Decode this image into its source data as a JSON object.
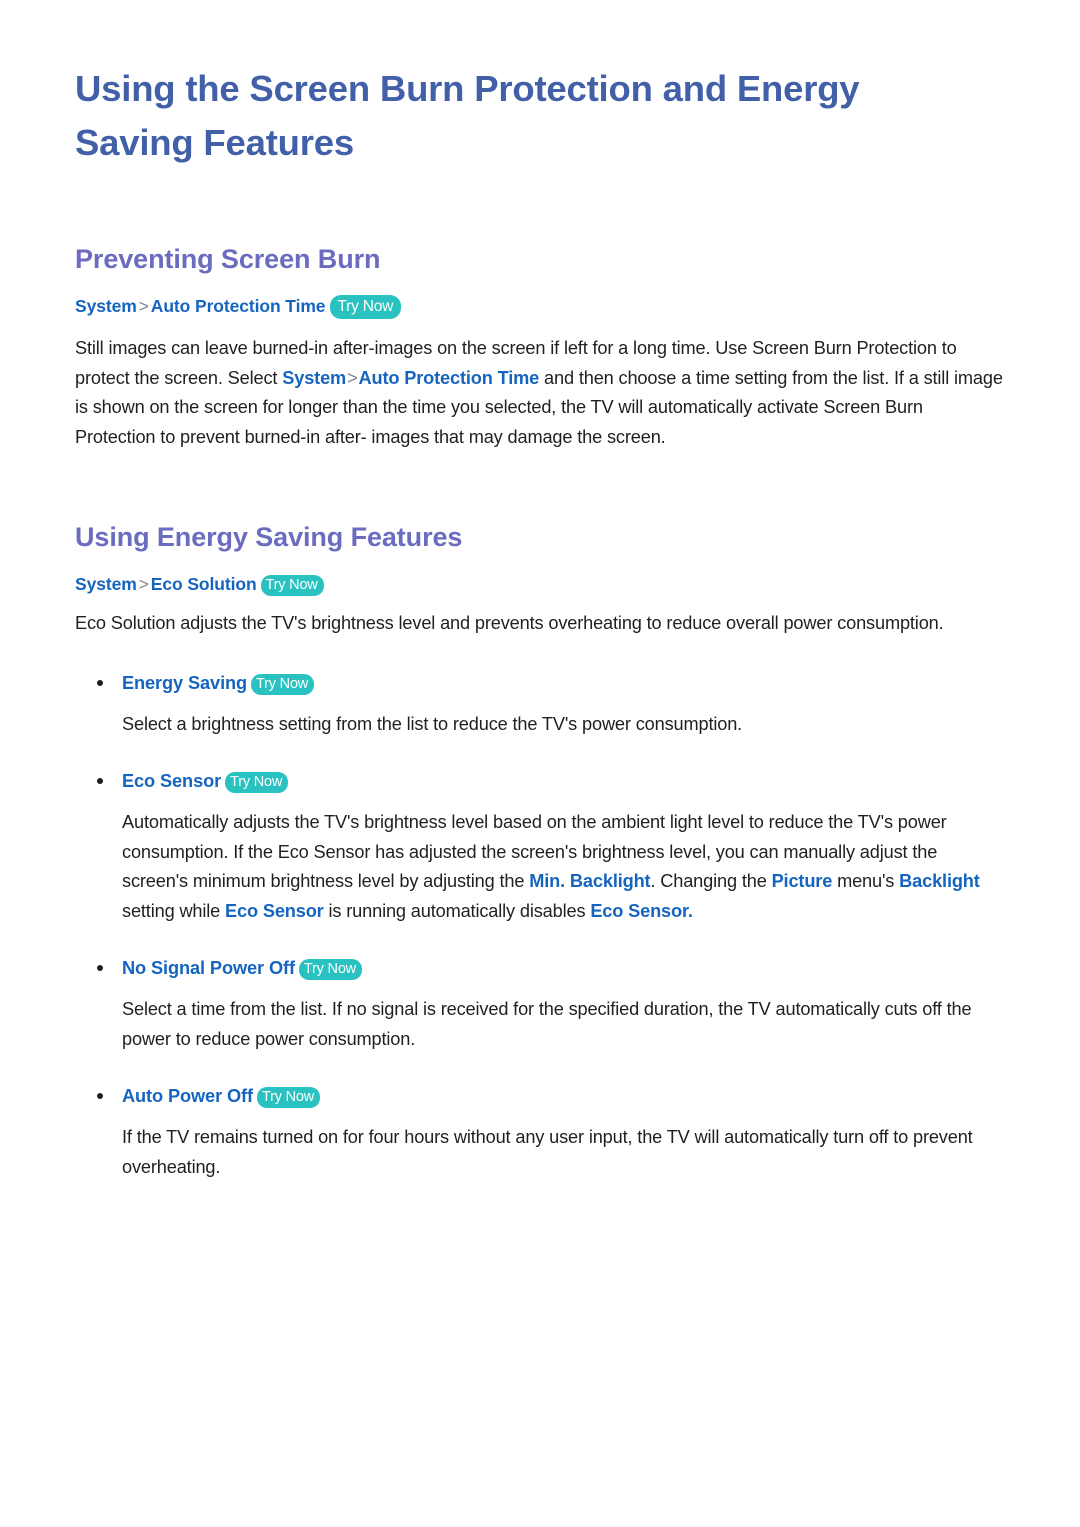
{
  "document": {
    "title": "Using the Screen Burn Protection and Energy Saving Features"
  },
  "colors": {
    "title": "#4260a8",
    "section_heading": "#6b6cc0",
    "link_blue": "#1565c0",
    "try_now_badge": "#2ac2c0",
    "body_text": "#231f20"
  },
  "sections": [
    {
      "heading": "Preventing Screen Burn",
      "breadcrumb": {
        "root": "System",
        "separator": ">",
        "leaf": "Auto Protection Time",
        "badge": "Try Now"
      },
      "paragraph": {
        "part1": "Still images can leave burned-in after-images on the screen if left for a long time. Use Screen Burn Protection to protect the screen. Select ",
        "link1": "System",
        "separator": ">",
        "link2": "Auto Protection Time",
        "part2": " and then choose a time setting from the list. If a still image is shown on the screen for longer than the time you selected, the TV will automatically activate Screen Burn Protection to prevent burned-in after- images that may damage the screen."
      }
    },
    {
      "heading": "Using Energy Saving Features",
      "breadcrumb": {
        "root": "System",
        "separator": ">",
        "leaf": "Eco Solution",
        "badge": "Try Now"
      },
      "intro": "Eco Solution adjusts the TV's brightness level and prevents overheating to reduce overall power consumption.",
      "bullets": [
        {
          "label": "Energy Saving",
          "badge": "Try Now",
          "body": {
            "text": "Select a brightness setting from the list to reduce the TV's power consumption."
          }
        },
        {
          "label": "Eco Sensor",
          "badge": "Try Now",
          "body": {
            "p1": "Automatically adjusts the TV's brightness level based on the ambient light level to reduce the TV's power consumption. If the Eco Sensor has adjusted the screen's brightness level, you can manually adjust the screen's minimum brightness level by adjusting the ",
            "link1": "Min. Backlight",
            "p2": ". Changing the ",
            "link2": "Picture",
            "p3": " menu's ",
            "link3": "Backlight",
            "p4": " setting while ",
            "link4": "Eco Sensor",
            "p5": " is running automatically disables ",
            "link5": "Eco Sensor",
            "p6": "."
          }
        },
        {
          "label": "No Signal Power Off",
          "badge": "Try Now",
          "body": {
            "text": "Select a time from the list. If no signal is received for the specified duration, the TV automatically cuts off the power to reduce power consumption."
          }
        },
        {
          "label": "Auto Power Off",
          "badge": "Try Now",
          "body": {
            "text": "If the TV remains turned on for four hours without any user input, the TV will automatically turn off to prevent overheating."
          }
        }
      ]
    }
  ]
}
